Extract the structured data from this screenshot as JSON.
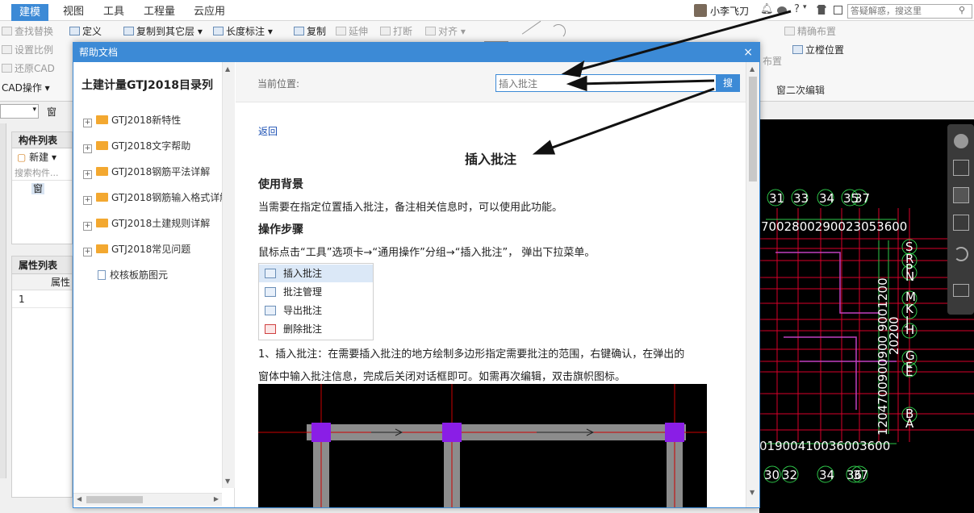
{
  "menu": {
    "tabs": [
      {
        "label": "建模",
        "active": true
      },
      {
        "label": "视图"
      },
      {
        "label": "工具"
      },
      {
        "label": "工程量"
      },
      {
        "label": "云应用"
      }
    ]
  },
  "user": {
    "name": "小李飞刀"
  },
  "top_search": {
    "placeholder": "答疑解惑，搜这里"
  },
  "toolbar": {
    "find_replace": "查找替换",
    "set_scale": "设置比例",
    "restore_cad": "还原CAD",
    "cad_ops": "CAD操作",
    "define": "定义",
    "copy_to_layer": "复制到其它层",
    "length_mark": "长度标注",
    "copy": "复制",
    "extend": "延伸",
    "break": "打断",
    "align": "对齐",
    "precise_layout": "精确布置",
    "elevation_pos": "立樘位置",
    "layout": "布置",
    "window_edit": "窗二次编辑"
  },
  "left_panel": {
    "combo_value": "窗",
    "component_list": "构件列表",
    "new_label": "新建",
    "search_placeholder": "搜索构件...",
    "item": "窗",
    "property_list": "属性列表",
    "property_header": "属性",
    "row_num": "1"
  },
  "cad": {
    "top_axis": [
      "31",
      "33",
      "34",
      "35",
      "37"
    ],
    "top_dims": "7002800290023053600",
    "bottom_dims": "01900410036003600",
    "bottom_axis": [
      "30",
      "32",
      "34",
      "36",
      "37"
    ],
    "right_axis": [
      "S",
      "R",
      "P",
      "N",
      "M",
      "K",
      "J",
      "H",
      "G",
      "F",
      "E",
      "B",
      "A"
    ],
    "vert_dims": "1204700900900 9001200",
    "vert_total": "20200"
  },
  "dialog": {
    "title": "帮助文档",
    "close": "×",
    "toc_title": "土建计量GTJ2018目录列",
    "toc": [
      {
        "label": "GTJ2018新特性",
        "type": "folder"
      },
      {
        "label": "GTJ2018文字帮助",
        "type": "folder"
      },
      {
        "label": "GTJ2018钢筋平法详解",
        "type": "folder"
      },
      {
        "label": "GTJ2018钢筋输入格式详解",
        "type": "folder"
      },
      {
        "label": "GTJ2018土建规则详解",
        "type": "folder"
      },
      {
        "label": "GTJ2018常见问题",
        "type": "folder"
      },
      {
        "label": "校核板筋图元",
        "type": "page"
      }
    ],
    "location_label": "当前位置:",
    "search_value": "插入批注",
    "search_button": "搜",
    "back": "返回",
    "article_title": "插入批注",
    "section1": "使用背景",
    "section1_text": "当需要在指定位置插入批注，备注相关信息时，可以使用此功能。",
    "section2": "操作步骤",
    "step_text": "鼠标点击“工具”选项卡→“通用操作”分组→“插入批注”， 弹出下拉菜单。",
    "popup": [
      "插入批注",
      "批注管理",
      "导出批注",
      "删除批注"
    ],
    "para1": "1、插入批注：在需要插入批注的地方绘制多边形指定需要批注的范围，右键确认，在弹出的",
    "para2": "窗体中输入批注信息，完成后关闭对话框即可。如需再次编辑，双击旗帜图标。"
  }
}
